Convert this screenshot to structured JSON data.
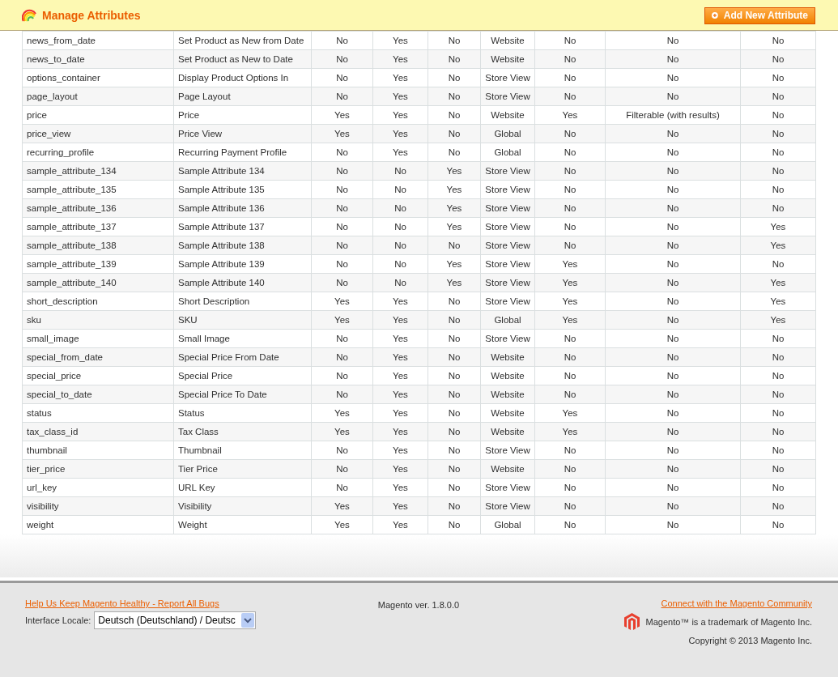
{
  "header": {
    "title": "Manage Attributes",
    "add_button": "Add New Attribute"
  },
  "table": {
    "rows": [
      [
        "news_from_date",
        "Set Product as New from Date",
        "No",
        "Yes",
        "No",
        "Website",
        "No",
        "No",
        "No"
      ],
      [
        "news_to_date",
        "Set Product as New to Date",
        "No",
        "Yes",
        "No",
        "Website",
        "No",
        "No",
        "No"
      ],
      [
        "options_container",
        "Display Product Options In",
        "No",
        "Yes",
        "No",
        "Store View",
        "No",
        "No",
        "No"
      ],
      [
        "page_layout",
        "Page Layout",
        "No",
        "Yes",
        "No",
        "Store View",
        "No",
        "No",
        "No"
      ],
      [
        "price",
        "Price",
        "Yes",
        "Yes",
        "No",
        "Website",
        "Yes",
        "Filterable (with results)",
        "No"
      ],
      [
        "price_view",
        "Price View",
        "Yes",
        "Yes",
        "No",
        "Global",
        "No",
        "No",
        "No"
      ],
      [
        "recurring_profile",
        "Recurring Payment Profile",
        "No",
        "Yes",
        "No",
        "Global",
        "No",
        "No",
        "No"
      ],
      [
        "sample_attribute_134",
        "Sample Attribute 134",
        "No",
        "No",
        "Yes",
        "Store View",
        "No",
        "No",
        "No"
      ],
      [
        "sample_attribute_135",
        "Sample Attribute 135",
        "No",
        "No",
        "Yes",
        "Store View",
        "No",
        "No",
        "No"
      ],
      [
        "sample_attribute_136",
        "Sample Attribute 136",
        "No",
        "No",
        "Yes",
        "Store View",
        "No",
        "No",
        "No"
      ],
      [
        "sample_attribute_137",
        "Sample Attribute 137",
        "No",
        "No",
        "Yes",
        "Store View",
        "No",
        "No",
        "Yes"
      ],
      [
        "sample_attribute_138",
        "Sample Attribute 138",
        "No",
        "No",
        "No",
        "Store View",
        "No",
        "No",
        "Yes"
      ],
      [
        "sample_attribute_139",
        "Sample Attribute 139",
        "No",
        "No",
        "Yes",
        "Store View",
        "Yes",
        "No",
        "No"
      ],
      [
        "sample_attribute_140",
        "Sample Attribute 140",
        "No",
        "No",
        "Yes",
        "Store View",
        "Yes",
        "No",
        "Yes"
      ],
      [
        "short_description",
        "Short Description",
        "Yes",
        "Yes",
        "No",
        "Store View",
        "Yes",
        "No",
        "Yes"
      ],
      [
        "sku",
        "SKU",
        "Yes",
        "Yes",
        "No",
        "Global",
        "Yes",
        "No",
        "Yes"
      ],
      [
        "small_image",
        "Small Image",
        "No",
        "Yes",
        "No",
        "Store View",
        "No",
        "No",
        "No"
      ],
      [
        "special_from_date",
        "Special Price From Date",
        "No",
        "Yes",
        "No",
        "Website",
        "No",
        "No",
        "No"
      ],
      [
        "special_price",
        "Special Price",
        "No",
        "Yes",
        "No",
        "Website",
        "No",
        "No",
        "No"
      ],
      [
        "special_to_date",
        "Special Price To Date",
        "No",
        "Yes",
        "No",
        "Website",
        "No",
        "No",
        "No"
      ],
      [
        "status",
        "Status",
        "Yes",
        "Yes",
        "No",
        "Website",
        "Yes",
        "No",
        "No"
      ],
      [
        "tax_class_id",
        "Tax Class",
        "Yes",
        "Yes",
        "No",
        "Website",
        "Yes",
        "No",
        "No"
      ],
      [
        "thumbnail",
        "Thumbnail",
        "No",
        "Yes",
        "No",
        "Store View",
        "No",
        "No",
        "No"
      ],
      [
        "tier_price",
        "Tier Price",
        "No",
        "Yes",
        "No",
        "Website",
        "No",
        "No",
        "No"
      ],
      [
        "url_key",
        "URL Key",
        "No",
        "Yes",
        "No",
        "Store View",
        "No",
        "No",
        "No"
      ],
      [
        "visibility",
        "Visibility",
        "Yes",
        "Yes",
        "No",
        "Store View",
        "No",
        "No",
        "No"
      ],
      [
        "weight",
        "Weight",
        "Yes",
        "Yes",
        "No",
        "Global",
        "No",
        "No",
        "No"
      ]
    ]
  },
  "footer": {
    "bug_link": "Help Us Keep Magento Healthy - Report All Bugs",
    "locale_label": "Interface Locale:",
    "locale_value": "Deutsch (Deutschland) / Deutsc",
    "version": "Magento ver. 1.8.0.0",
    "community_link": "Connect with the Magento Community",
    "trademark": "Magento™ is a trademark of Magento Inc.",
    "copyright": "Copyright © 2013 Magento Inc."
  }
}
